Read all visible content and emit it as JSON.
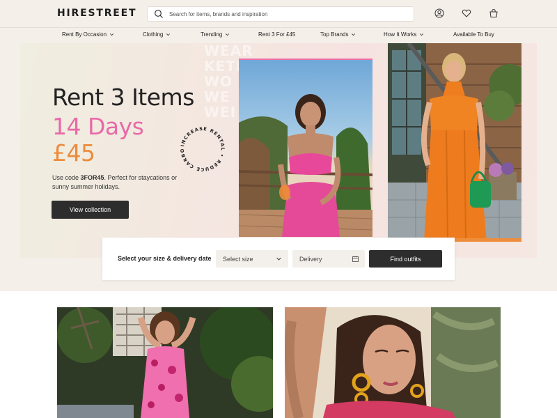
{
  "header": {
    "logo": "HIRESTREET",
    "search_placeholder": "Search for items, brands and inspiration",
    "icons": [
      "account-icon",
      "heart-icon",
      "bag-icon"
    ]
  },
  "nav": {
    "items": [
      {
        "label": "Rent By Occasion",
        "has_dropdown": true
      },
      {
        "label": "Clothing",
        "has_dropdown": true
      },
      {
        "label": "Trending",
        "has_dropdown": true
      },
      {
        "label": "Rent 3 For £45",
        "has_dropdown": false
      },
      {
        "label": "Top Brands",
        "has_dropdown": true
      },
      {
        "label": "How It Works",
        "has_dropdown": true
      },
      {
        "label": "Available To Buy",
        "has_dropdown": false
      }
    ]
  },
  "hero": {
    "line1": "Rent 3 Items",
    "line2": "14 Days",
    "line3": "£45",
    "promo_prefix": "Use code ",
    "promo_code": "3FOR45",
    "promo_suffix": ". Perfect for staycations or sunny summer holidays.",
    "cta": "View collection",
    "badge_text": "INCREASE RENTAL • REDUCE CARBON •",
    "bg_words": "WEAR\nKETI\nWO\nWE\nWEI",
    "colors": {
      "pink": "#e86aa8",
      "orange": "#ec8c3b",
      "dark": "#2d2d2d"
    }
  },
  "finder": {
    "label": "Select your size & delivery date",
    "size_placeholder": "Select size",
    "delivery_placeholder": "Delivery",
    "button": "Find outfits"
  }
}
